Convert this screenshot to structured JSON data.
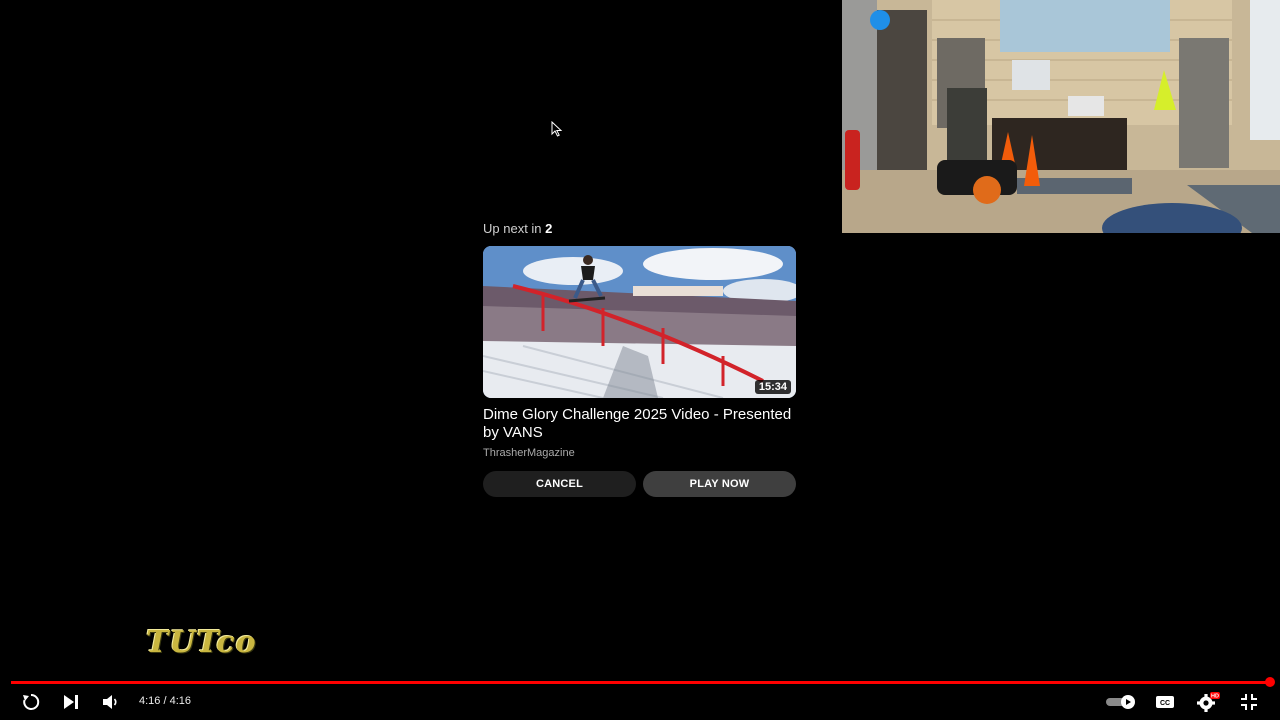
{
  "up_next": {
    "prefix": "Up next in",
    "countdown": "2",
    "duration": "15:34",
    "title": "Dime Glory Challenge 2025 Video - Presented by VANS",
    "channel": "ThrasherMagazine",
    "cancel_label": "CANCEL",
    "play_now_label": "PLAY NOW"
  },
  "watermark": "TUTco",
  "player": {
    "time_current": "4:16",
    "time_total": "4:16",
    "time_separator": " / ",
    "progress_fraction": 1.0,
    "progress_color": "#ff0000",
    "icons": {
      "replay": "replay-icon",
      "next": "next-icon",
      "volume": "volume-icon",
      "autoplay": "autoplay-toggle-icon",
      "captions": "captions-icon",
      "settings": "settings-icon",
      "exit_fullscreen": "exit-fullscreen-icon"
    },
    "settings_badge": "HD"
  }
}
